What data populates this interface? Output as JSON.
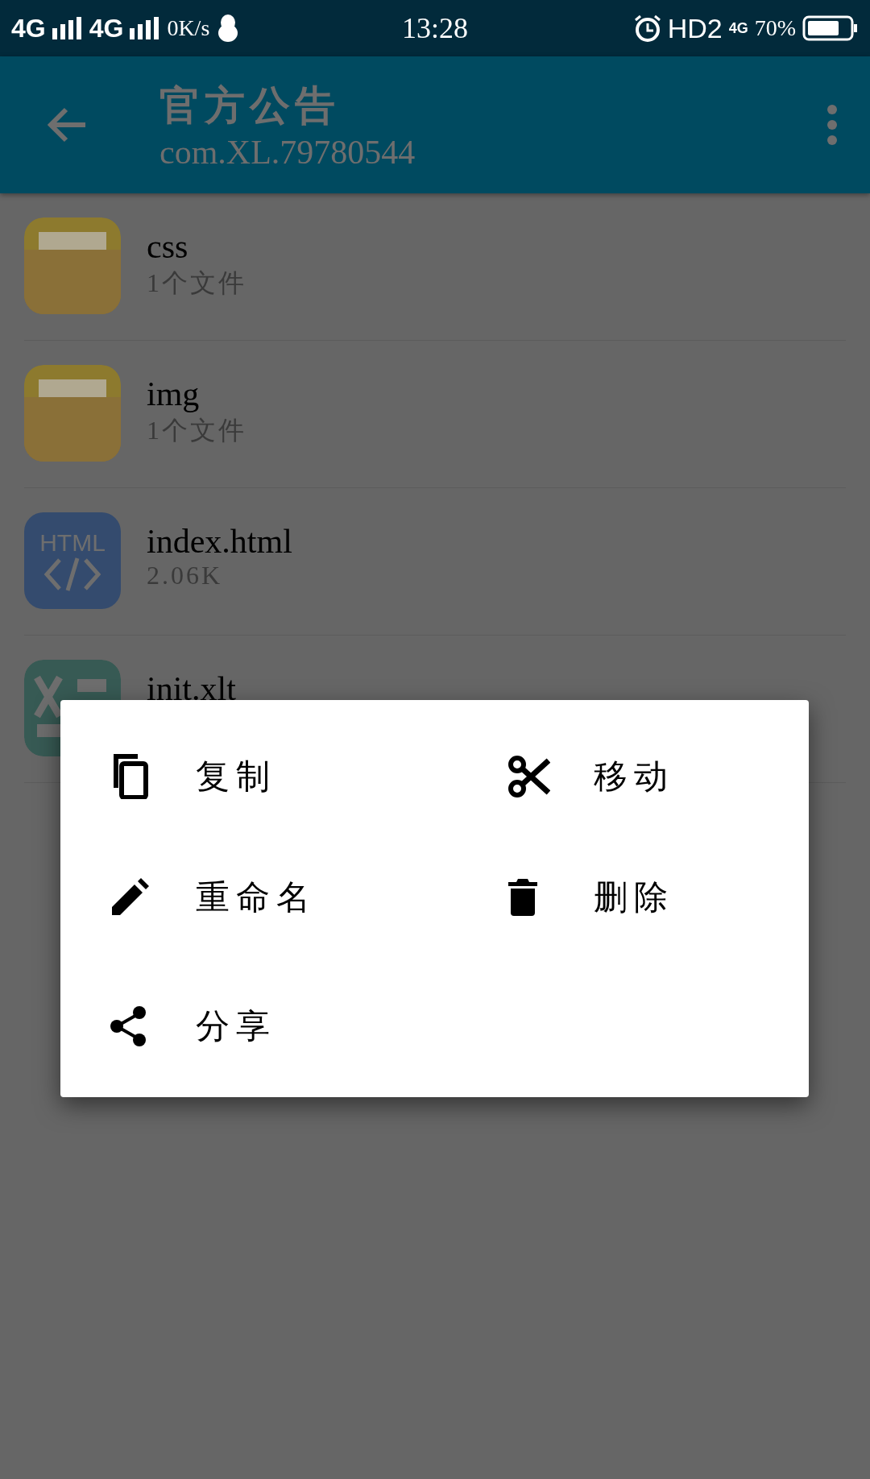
{
  "status_bar": {
    "network_1": "4G",
    "network_2": "4G",
    "speed": "0K/s",
    "time": "13:28",
    "hd": "HD2",
    "data": "4G",
    "battery": "70%"
  },
  "app_bar": {
    "title": "官方公告",
    "subtitle": "com.XL.79780544"
  },
  "files": [
    {
      "kind": "folder",
      "name": "css",
      "info": "1个文件"
    },
    {
      "kind": "folder",
      "name": "img",
      "info": "1个文件"
    },
    {
      "kind": "html",
      "name": "index.html",
      "info": "2.06K",
      "icon_text": "HTML"
    },
    {
      "kind": "sheet",
      "name": "init.xlt"
    }
  ],
  "menu": {
    "items": [
      {
        "label": "复制"
      },
      {
        "label": "移动"
      },
      {
        "label": "重命名"
      },
      {
        "label": "删除"
      },
      {
        "label": "分享"
      }
    ]
  }
}
